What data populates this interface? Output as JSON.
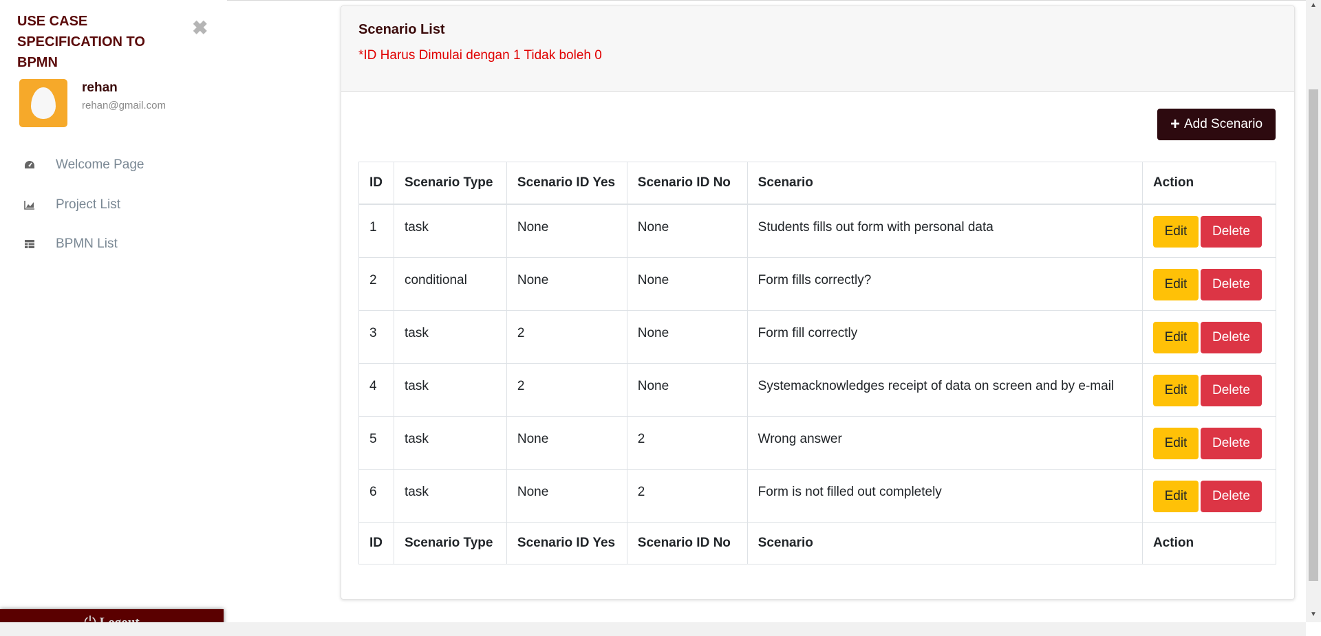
{
  "app": {
    "title": "USE CASE SPECIFICATION TO BPMN",
    "close_icon": "times-icon"
  },
  "user": {
    "name": "rehan",
    "email": "rehan@gmail.com",
    "avatar_icon": "egg-avatar-icon",
    "avatar_color": "#f6a92a"
  },
  "nav": [
    {
      "label": "Welcome Page",
      "icon": "dashboard-icon"
    },
    {
      "label": "Project List",
      "icon": "chart-icon"
    },
    {
      "label": "BPMN List",
      "icon": "table-icon"
    }
  ],
  "logout": {
    "label": "Logout",
    "icon": "power-icon",
    "color": "#5a0000"
  },
  "card": {
    "title": "Scenario List",
    "note": "*ID Harus Dimulai dengan 1 Tidak boleh 0",
    "add_label": "Add Scenario"
  },
  "table": {
    "headers": [
      "ID",
      "Scenario Type",
      "Scenario ID Yes",
      "Scenario ID No",
      "Scenario",
      "Action"
    ],
    "rows": [
      {
        "id": "1",
        "type": "task",
        "yes": "None",
        "no": "None",
        "scenario": "Students fills out form with personal data"
      },
      {
        "id": "2",
        "type": "conditional",
        "yes": "None",
        "no": "None",
        "scenario": "Form fills correctly?"
      },
      {
        "id": "3",
        "type": "task",
        "yes": "2",
        "no": "None",
        "scenario": "Form fill correctly"
      },
      {
        "id": "4",
        "type": "task",
        "yes": "2",
        "no": "None",
        "scenario": "Systemacknowledges receipt of data on screen and by e-mail"
      },
      {
        "id": "5",
        "type": "task",
        "yes": "None",
        "no": "2",
        "scenario": "Wrong answer"
      },
      {
        "id": "6",
        "type": "task",
        "yes": "None",
        "no": "2",
        "scenario": "Form is not filled out completely"
      }
    ],
    "edit_label": "Edit",
    "delete_label": "Delete"
  },
  "colors": {
    "brand": "#5a0a0a",
    "add_button": "#2d0a0f",
    "edit_button": "#ffc107",
    "delete_button": "#dc3545",
    "note": "#e00000"
  }
}
